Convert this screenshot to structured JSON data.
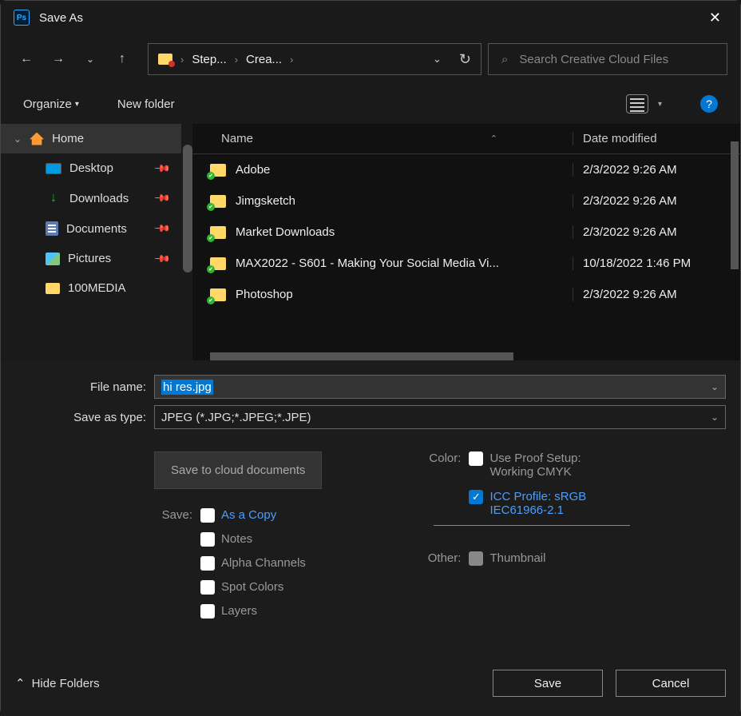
{
  "title": "Save As",
  "breadcrumbs": [
    "Step...",
    "Crea..."
  ],
  "search_placeholder": "Search Creative Cloud Files",
  "toolbar": {
    "organize": "Organize",
    "new_folder": "New folder"
  },
  "sidebar": {
    "home": "Home",
    "items": [
      {
        "label": "Desktop"
      },
      {
        "label": "Downloads"
      },
      {
        "label": "Documents"
      },
      {
        "label": "Pictures"
      },
      {
        "label": "100MEDIA"
      }
    ]
  },
  "columns": {
    "name": "Name",
    "date": "Date modified"
  },
  "files": [
    {
      "name": "Adobe",
      "date": "2/3/2022 9:26 AM"
    },
    {
      "name": "Jimgsketch",
      "date": "2/3/2022 9:26 AM"
    },
    {
      "name": "Market Downloads",
      "date": "2/3/2022 9:26 AM"
    },
    {
      "name": "MAX2022 - S601 - Making Your Social Media Vi...",
      "date": "10/18/2022 1:46 PM"
    },
    {
      "name": "Photoshop",
      "date": "2/3/2022 9:26 AM"
    }
  ],
  "form": {
    "filename_label": "File name:",
    "filename_value": "hi res.jpg",
    "type_label": "Save as type:",
    "type_value": "JPEG (*.JPG;*.JPEG;*.JPE)"
  },
  "cloud_button": "Save to cloud documents",
  "save_section": {
    "label": "Save:",
    "as_copy": "As a Copy",
    "notes": "Notes",
    "alpha": "Alpha Channels",
    "spot": "Spot Colors",
    "layers": "Layers"
  },
  "color_section": {
    "label": "Color:",
    "proof1": "Use Proof Setup:",
    "proof2": "Working CMYK",
    "icc1": "ICC Profile:  sRGB",
    "icc2": "IEC61966-2.1"
  },
  "other_section": {
    "label": "Other:",
    "thumbnail": "Thumbnail"
  },
  "footer": {
    "hide_folders": "Hide Folders",
    "save": "Save",
    "cancel": "Cancel"
  }
}
